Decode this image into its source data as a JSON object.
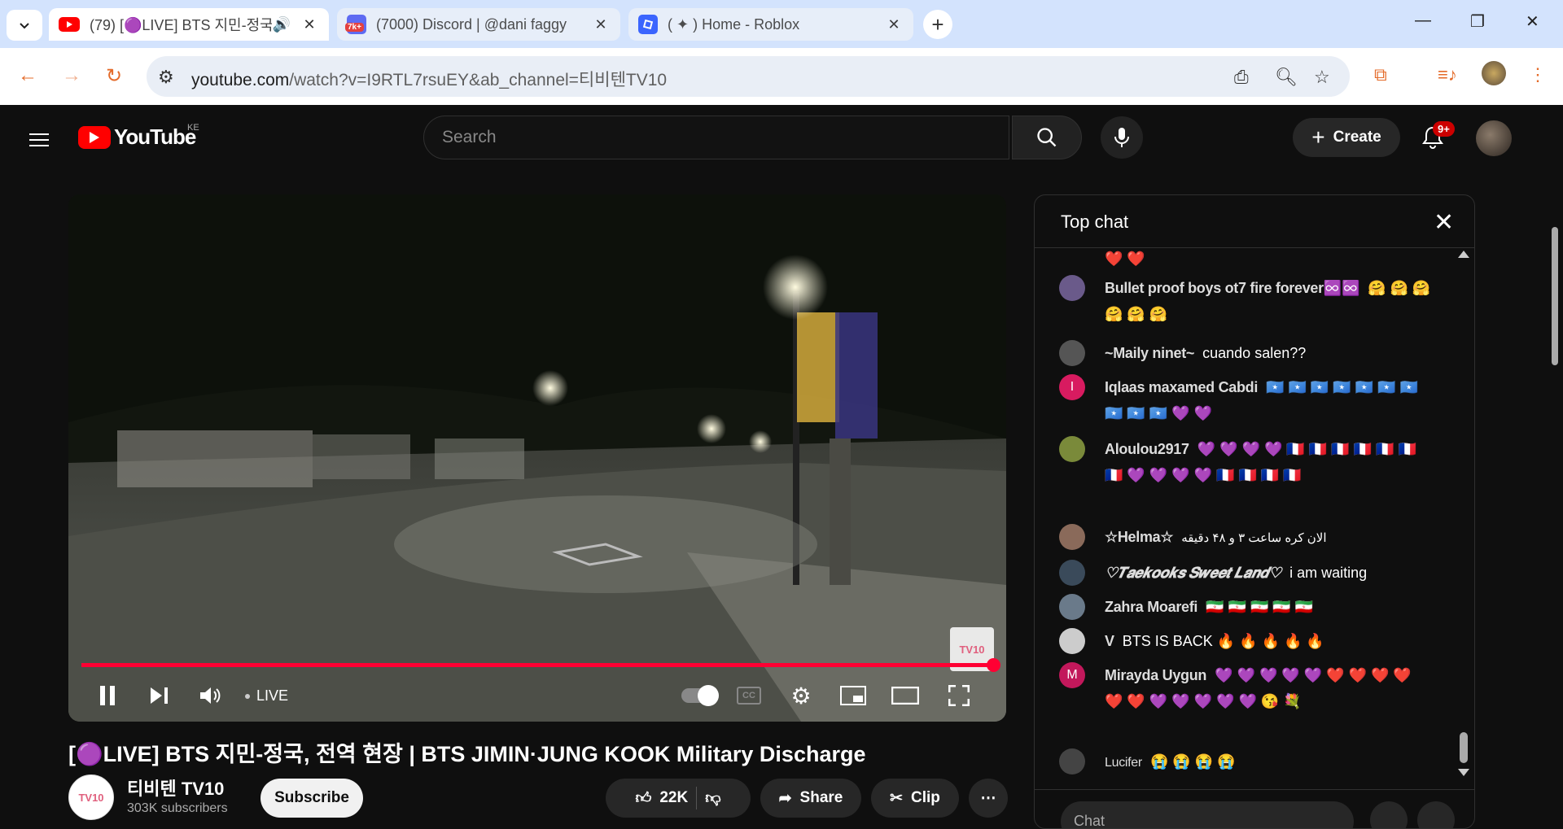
{
  "browser": {
    "tabs": [
      {
        "title": "(79) [🟣LIVE] BTS 지민-정국",
        "active": true,
        "has_audio": true
      },
      {
        "title": "(7000) Discord | @dani faggy",
        "active": false,
        "badge": "7k+"
      },
      {
        "title": "( ✦ ) Home - Roblox",
        "active": false
      }
    ],
    "url_host": "youtube.com",
    "url_rest": "/watch?v=I9RTL7rsuEY&ab_channel=티비텐TV10"
  },
  "youtube": {
    "logo_text": "YouTube",
    "country_code": "KE",
    "search_placeholder": "Search",
    "create_label": "Create",
    "notif_badge": "9+"
  },
  "player": {
    "live_label": "LIVE",
    "watermark": "TV10",
    "progress": 1.0
  },
  "video": {
    "title": "[🟣LIVE] BTS 지민-정국, 전역 현장 | BTS JIMIN·JUNG KOOK Military Discharge",
    "channel_name": "티비텐 TV10",
    "channel_avatar_text": "TV10",
    "subscribers": "303K subscribers",
    "subscribe_label": "Subscribe",
    "likes": "22K",
    "share_label": "Share",
    "clip_label": "Clip"
  },
  "chat": {
    "title": "Top chat",
    "input_placeholder": "Chat",
    "messages": [
      {
        "author": "",
        "text": "❤️ ❤️",
        "avatar_color": "transparent",
        "avatar_text": ""
      },
      {
        "author": "Bullet proof boys ot7 fire forever♾️♾️",
        "text": "🤗 🤗 🤗 🤗 🤗 🤗",
        "avatar_color": "#6a5a8a",
        "avatar_text": ""
      },
      {
        "author": "~Maily ninet~",
        "text": "cuando salen??",
        "avatar_color": "#555",
        "avatar_text": ""
      },
      {
        "author": "Iqlaas maxamed Cabdi",
        "text": "🇸🇴 🇸🇴 🇸🇴 🇸🇴 🇸🇴 🇸🇴 🇸🇴 🇸🇴 🇸🇴 🇸🇴 💜 💜",
        "avatar_color": "#d81b60",
        "avatar_text": "I"
      },
      {
        "author": "Aloulou2917",
        "text": "💜 💜 💜 💜 🇫🇷 🇫🇷 🇫🇷 🇫🇷 🇫🇷 🇫🇷 🇫🇷 💜 💜 💜 💜 🇫🇷 🇫🇷 🇫🇷 🇫🇷",
        "avatar_color": "#7a8a3a",
        "avatar_text": ""
      },
      {
        "author": "☆Helma☆",
        "text": "الان کره ساعت ۳ و ۴۸ دقیقه",
        "avatar_color": "#8a6a5a",
        "avatar_text": ""
      },
      {
        "author": "♡𝑻𝒂𝒆𝒌𝒐𝒐𝒌𝒔 𝑺𝒘𝒆𝒆𝒕 𝑳𝒂𝒏𝒅♡",
        "text": "i am waiting",
        "avatar_color": "#3a4a5a",
        "avatar_text": ""
      },
      {
        "author": "Zahra Moarefi",
        "text": "🇮🇷 🇮🇷 🇮🇷 🇮🇷 🇮🇷",
        "avatar_color": "#6a7a8a",
        "avatar_text": ""
      },
      {
        "author": "V",
        "text": "BTS IS BACK 🔥 🔥 🔥 🔥 🔥",
        "avatar_color": "#ccc",
        "avatar_text": ""
      },
      {
        "author": "Mirayda Uygun",
        "text": "💜 💜 💜 💜 💜 ❤️ ❤️ ❤️ ❤️ ❤️ ❤️ 💜 💜 💜 💜 💜 😘 💐",
        "avatar_color": "#c2185b",
        "avatar_text": "M"
      },
      {
        "author": "Lucifer",
        "text": "😭 😭 😭 😭",
        "avatar_color": "#444",
        "avatar_text": ""
      }
    ]
  }
}
